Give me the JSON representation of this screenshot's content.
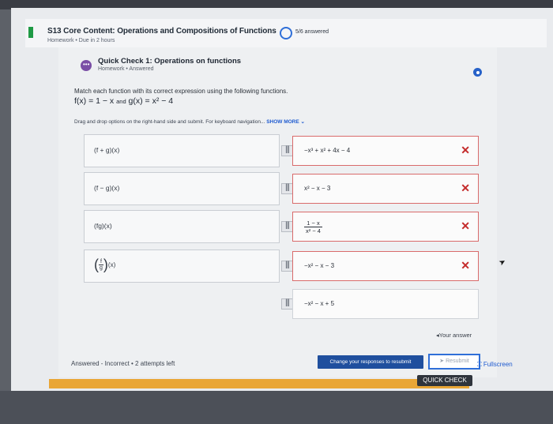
{
  "header": {
    "title": "S13 Core Content: Operations and Compositions of Functions",
    "subtitle": "Homework • Due in 2 hours",
    "progress": "5/6 answered",
    "progress_fraction": 0.833
  },
  "card": {
    "title": "Quick Check 1: Operations on functions",
    "subtitle": "Homework • Answered",
    "instruction": "Match each function with its correct expression using the following functions.",
    "functions": {
      "f_label": "f(x) = 1 − x",
      "and": "and",
      "g_label": "g(x) = x² − 4"
    },
    "drag_hint": "Drag and drop options on the right-hand side and submit. For keyboard navigation...",
    "show_more": "SHOW MORE ⌄"
  },
  "rows": [
    {
      "left": "(f + g)(x)",
      "answer": "−x³ + x² + 4x − 4",
      "status": "incorrect"
    },
    {
      "left": "(f − g)(x)",
      "answer": "x² − x − 3",
      "status": "incorrect"
    },
    {
      "left": "(fg)(x)",
      "answer_num": "1 − x",
      "answer_den": "x² − 4",
      "status": "incorrect"
    },
    {
      "left_num": "f",
      "left_den": "g",
      "left_suffix": "(x)",
      "answer": "−x² − x − 3",
      "status": "incorrect"
    },
    {
      "answer": "−x² − x + 5",
      "status": "unplaced"
    }
  ],
  "x_symbol": "✕",
  "drag_handle": "|||",
  "your_answer": "Your answer",
  "footer": {
    "status": "Answered - Incorrect • 2 attempts left",
    "change_button": "Change your responses to resubmit",
    "resubmit_button": "Resubmit",
    "fullscreen": "Fullscreen",
    "quick_check": "QUICK CHECK"
  },
  "colors": {
    "accent_green": "#1f9a45",
    "accent_blue": "#2f6fd8",
    "error_red": "#c42a2a",
    "quick_check_bar": "#e9a636"
  }
}
